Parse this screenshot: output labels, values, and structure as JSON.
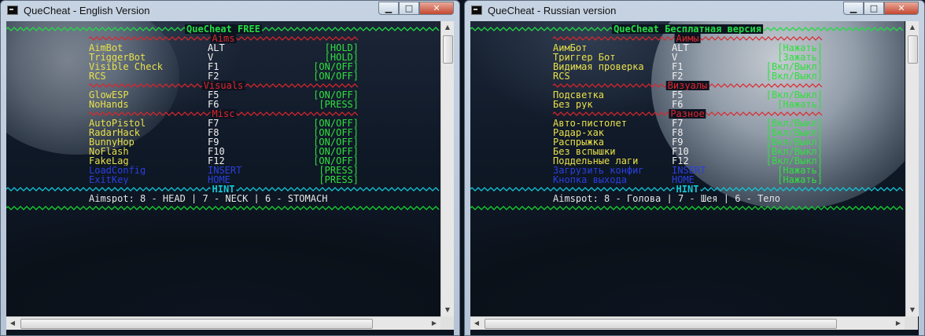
{
  "windows": {
    "english": {
      "title": "QueCheat - English Version",
      "console_title": "QueCheat FREE",
      "sections": [
        {
          "title": "Aims",
          "rows": [
            {
              "name": "AimBot",
              "key": "ALT",
              "mode": "[HOLD]"
            },
            {
              "name": "TriggerBot",
              "key": "V",
              "mode": "[HOLD]"
            },
            {
              "name": "Visible Check",
              "key": "F1",
              "mode": "[ON/OFF]"
            },
            {
              "name": "RCS",
              "key": "F2",
              "mode": "[ON/OFF]"
            }
          ]
        },
        {
          "title": "Visuals",
          "rows": [
            {
              "name": "GlowESP",
              "key": "F5",
              "mode": "[ON/OFF]"
            },
            {
              "name": "NoHands",
              "key": "F6",
              "mode": "[PRESS]"
            }
          ]
        },
        {
          "title": "Misc",
          "rows": [
            {
              "name": "AutoPistol",
              "key": "F7",
              "mode": "[ON/OFF]"
            },
            {
              "name": "RadarHack",
              "key": "F8",
              "mode": "[ON/OFF]"
            },
            {
              "name": "BunnyHop",
              "key": "F9",
              "mode": "[ON/OFF]"
            },
            {
              "name": "NoFlash",
              "key": "F10",
              "mode": "[ON/OFF]"
            },
            {
              "name": "FakeLag",
              "key": "F12",
              "mode": "[ON/OFF]"
            },
            {
              "name": "LoadConfig",
              "key": "INSERT",
              "mode": "[PRESS]",
              "blue": true
            },
            {
              "name": "ExitKey",
              "key": "HOME",
              "mode": "[PRESS]",
              "blue": true
            }
          ]
        }
      ],
      "hint_label": "HINT",
      "hint_text": "Aimspot: 8 - HEAD | 7 - NECK | 6 - STOMACH"
    },
    "russian": {
      "title": "QueCheat - Russian version",
      "console_title": "QueCheat Бесплатная версия",
      "sections": [
        {
          "title": "Аимы",
          "rows": [
            {
              "name": "АимБот",
              "key": "ALT",
              "mode": "[Нажать]"
            },
            {
              "name": "Триггер Бот",
              "key": "V",
              "mode": "[Зажать]"
            },
            {
              "name": "Видимая проверка",
              "key": "F1",
              "mode": "[Вкл/Выкл]"
            },
            {
              "name": "RCS",
              "key": "F2",
              "mode": "[Вкл/Выкл]"
            }
          ]
        },
        {
          "title": "Визуалы",
          "rows": [
            {
              "name": "Подсветка",
              "key": "F5",
              "mode": "[Вкл/Выкл]"
            },
            {
              "name": "Без рук",
              "key": "F6",
              "mode": "[Нажать]"
            }
          ]
        },
        {
          "title": "Разное",
          "rows": [
            {
              "name": "Авто-пистолет",
              "key": "F7",
              "mode": "[Вкл/Выкл]"
            },
            {
              "name": "Радар-хак",
              "key": "F8",
              "mode": "[Вкл/Выкл]"
            },
            {
              "name": "Распрыжка",
              "key": "F9",
              "mode": "[Вкл/Выкл]"
            },
            {
              "name": "Без вспышки",
              "key": "F10",
              "mode": "[Вкл/Выкл]"
            },
            {
              "name": "Поддельные лаги",
              "key": "F12",
              "mode": "[Вкл/Выкл]"
            },
            {
              "name": "Загрузить конфиг",
              "key": "INSERT",
              "mode": "[Нажать]",
              "blue": true
            },
            {
              "name": "Кнопка выхода",
              "key": "HOME",
              "mode": "[Нажать]",
              "blue": true
            }
          ]
        }
      ],
      "hint_label": "HINT",
      "hint_text": "Aimspot: 8 - Голова | 7 - Шея | 6 - Тело"
    }
  },
  "window_buttons": {
    "minimize": "▁",
    "maximize": "□",
    "close": "✕"
  },
  "scroll_arrows": {
    "up": "▲",
    "down": "▼",
    "left": "◀",
    "right": "▶"
  },
  "colors": {
    "separator": "#16d431",
    "title": "#22dd44",
    "section": "#e0252c",
    "feature_name": "#e8e04a",
    "feature_key": "#f0f0f0",
    "feature_mode": "#2fe03e",
    "blue_entry": "#2a3fe0",
    "hint": "#12c8d8",
    "aimspot": "#e6e6e6"
  }
}
